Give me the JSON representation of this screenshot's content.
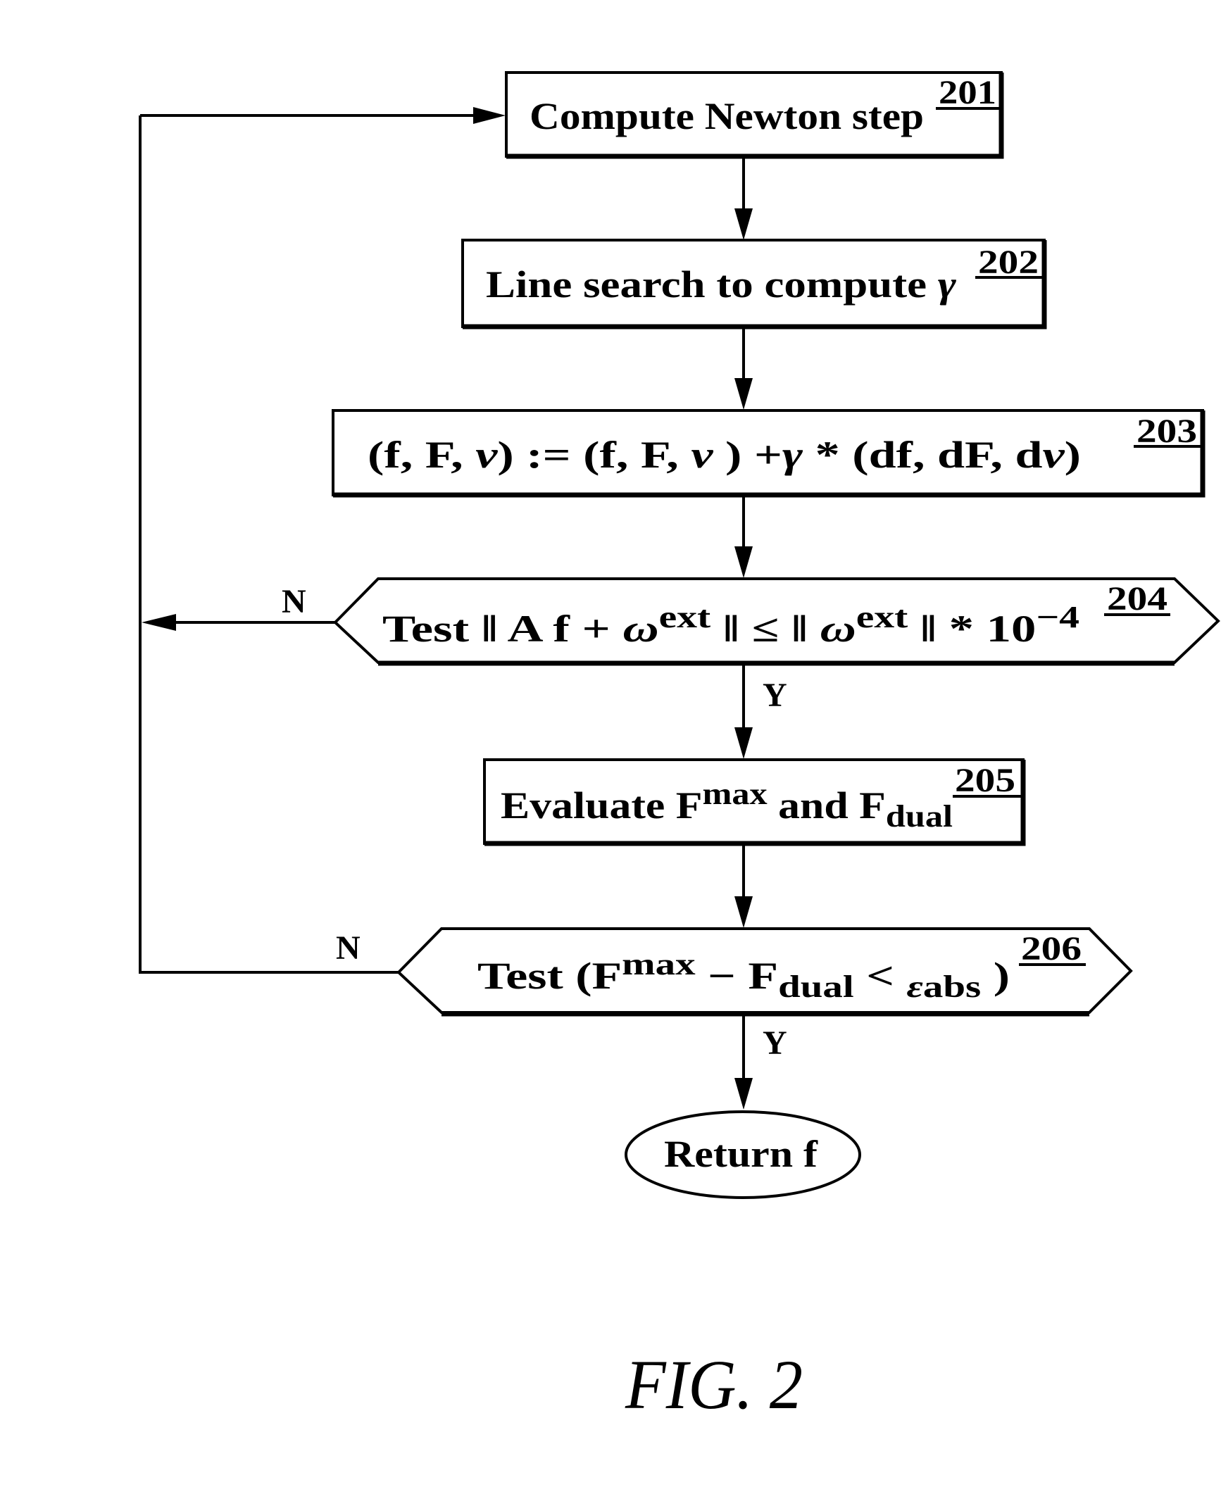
{
  "figure": {
    "caption": "FIG. 2",
    "type": "flowchart"
  },
  "nodes": [
    {
      "id": "201",
      "shape": "rectangle",
      "ref": "201",
      "parts": [
        {
          "t": "Compute  Newton  step"
        }
      ]
    },
    {
      "id": "202",
      "shape": "rectangle",
      "ref": "202",
      "parts": [
        {
          "t": "Line  search  to  compute "
        },
        {
          "t": "γ",
          "style": "italic"
        }
      ]
    },
    {
      "id": "203",
      "shape": "rectangle",
      "ref": "203",
      "parts": [
        {
          "t": "(f,  F, "
        },
        {
          "t": "ν",
          "style": "italic"
        },
        {
          "t": ")  :=  (f,  F, "
        },
        {
          "t": "ν",
          "style": "italic"
        },
        {
          "t": " )  +"
        },
        {
          "t": "γ",
          "style": "italic"
        },
        {
          "t": " * (df,  dF,  d"
        },
        {
          "t": "ν",
          "style": "italic"
        },
        {
          "t": ")"
        }
      ]
    },
    {
      "id": "204",
      "shape": "hexagon",
      "ref": "204",
      "parts": [
        {
          "t": "Test  ‖  A  f  + "
        },
        {
          "t": "ω",
          "style": "italic"
        },
        {
          "t": "ext",
          "sup": true
        },
        {
          "t": " ‖  ≤  ‖ "
        },
        {
          "t": "ω",
          "style": "italic"
        },
        {
          "t": "ext",
          "sup": true
        },
        {
          "t": " ‖  *  10"
        },
        {
          "t": "−4",
          "sup": true
        }
      ]
    },
    {
      "id": "205",
      "shape": "rectangle",
      "ref": "205",
      "parts": [
        {
          "t": "Evaluate  F"
        },
        {
          "t": "max",
          "sup": true
        },
        {
          "t": " and  F"
        },
        {
          "t": "dual",
          "sub": true
        }
      ]
    },
    {
      "id": "206",
      "shape": "hexagon",
      "ref": "206",
      "parts": [
        {
          "t": "Test  (F"
        },
        {
          "t": "max",
          "sup": true
        },
        {
          "t": "  −  F"
        },
        {
          "t": "dual",
          "sub": true
        },
        {
          "t": " < "
        },
        {
          "t": "ε",
          "style": "italic",
          "sub": true
        },
        {
          "t": "abs",
          "sub": true
        },
        {
          "t": " )"
        }
      ]
    },
    {
      "id": "end",
      "shape": "ellipse",
      "ref": "",
      "parts": [
        {
          "t": "Return  f"
        }
      ]
    }
  ],
  "edges": [
    {
      "from": "201",
      "to": "202",
      "label": ""
    },
    {
      "from": "202",
      "to": "203",
      "label": ""
    },
    {
      "from": "203",
      "to": "204",
      "label": ""
    },
    {
      "from": "204",
      "to": "205",
      "label": "Y"
    },
    {
      "from": "204",
      "to": "201",
      "label": "N"
    },
    {
      "from": "205",
      "to": "206",
      "label": ""
    },
    {
      "from": "206",
      "to": "end",
      "label": "Y"
    },
    {
      "from": "206",
      "to": "201",
      "label": "N"
    }
  ],
  "labels": {
    "yes": "Y",
    "no": "N"
  }
}
